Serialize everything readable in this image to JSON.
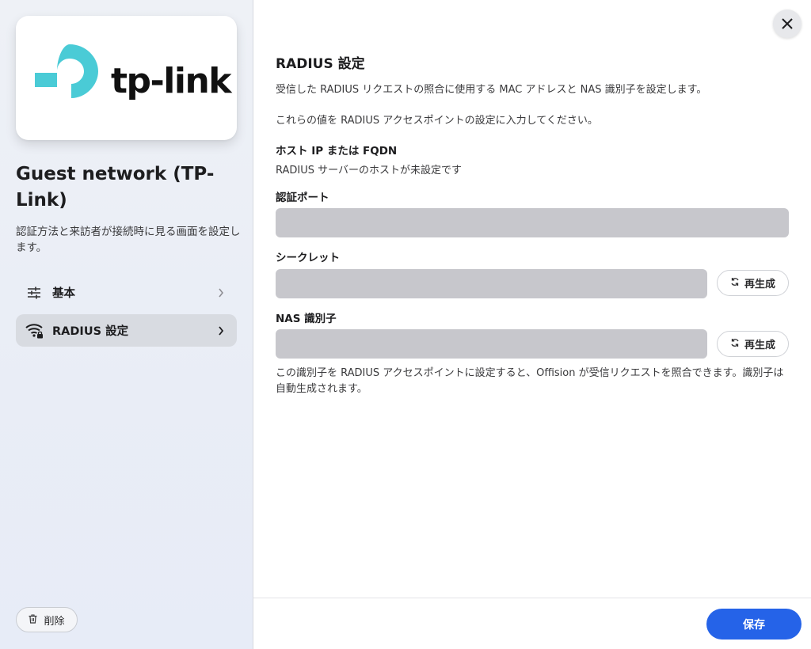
{
  "brand": {
    "wordmark": "tp-link",
    "color": "#4acbd6"
  },
  "sidebar": {
    "title": "Guest network (TP-Link)",
    "description": "認証方法と来訪者が接続時に見る画面を設定します。",
    "items": [
      {
        "label": "基本",
        "icon": "sliders-icon",
        "active": false
      },
      {
        "label": "RADIUS 設定",
        "icon": "wifi-lock-icon",
        "active": true
      }
    ],
    "delete_label": "削除"
  },
  "main": {
    "title": "RADIUS 設定",
    "intro1": "受信した RADIUS リクエストの照合に使用する MAC アドレスと NAS 識別子を設定します。",
    "intro2": "これらの値を RADIUS アクセスポイントの設定に入力してください。",
    "host": {
      "label": "ホスト IP または FQDN",
      "value": "RADIUS サーバーのホストが未設定です"
    },
    "auth_port": {
      "label": "認証ポート",
      "value": ""
    },
    "secret": {
      "label": "シークレット",
      "value": "",
      "regenerate_label": "再生成"
    },
    "nas_id": {
      "label": "NAS 識別子",
      "value": "",
      "regenerate_label": "再生成"
    },
    "note": "この識別子を RADIUS アクセスポイントに設定すると、Offision が受信リクエストを照合できます。識別子は自動生成されます。",
    "save_label": "保存"
  },
  "colors": {
    "accent": "#2563e8",
    "field_bg": "#c7c7cc"
  }
}
